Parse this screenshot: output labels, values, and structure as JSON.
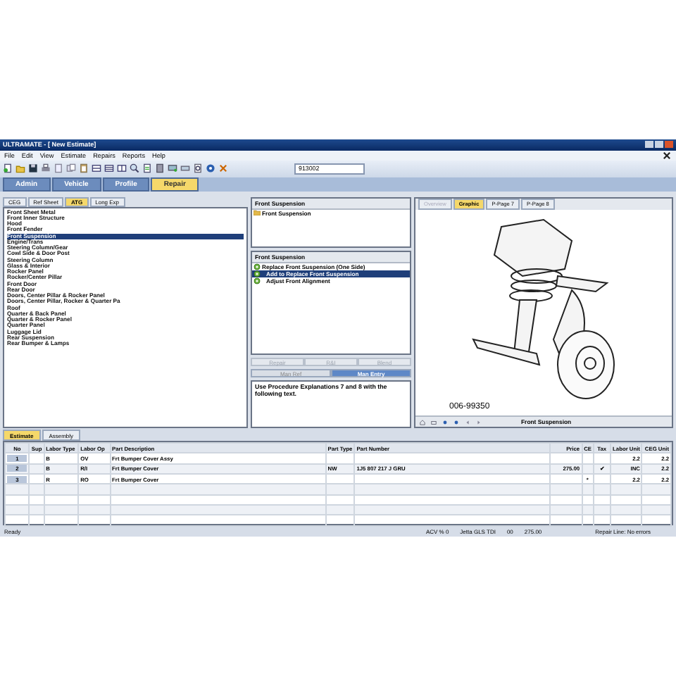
{
  "window": {
    "title": "ULTRAMATE - [ New Estimate]"
  },
  "menu": [
    "File",
    "Edit",
    "View",
    "Estimate",
    "Repairs",
    "Reports",
    "Help"
  ],
  "toolbar": {
    "field_value": "913002"
  },
  "nav_tabs": [
    {
      "label": "Admin",
      "selected": false
    },
    {
      "label": "Vehicle",
      "selected": false
    },
    {
      "label": "Profile",
      "selected": false
    },
    {
      "label": "Repair",
      "selected": true
    }
  ],
  "source_tabs": [
    {
      "label": "CEG",
      "selected": false
    },
    {
      "label": "Ref Sheet",
      "selected": false
    },
    {
      "label": "ATG",
      "selected": true
    },
    {
      "label": "Long Exp",
      "selected": false
    }
  ],
  "sections": [
    {
      "label": "Front Sheet Metal",
      "selected": false
    },
    {
      "label": "Front Inner Structure",
      "selected": false
    },
    {
      "label": "Hood",
      "selected": false
    },
    {
      "label": "Front Fender",
      "selected": false
    },
    {
      "label": "Front Suspension",
      "selected": true
    },
    {
      "label": "Engine/Trans",
      "selected": false
    },
    {
      "label": "Steering Column/Gear",
      "selected": false
    },
    {
      "label": "Cowl Side & Door Post",
      "selected": false
    },
    {
      "label": "Steering Column",
      "selected": false
    },
    {
      "label": "Glass & Interior",
      "selected": false
    },
    {
      "label": "Rocker Panel",
      "selected": false
    },
    {
      "label": "Rocker/Center Pillar",
      "selected": false
    },
    {
      "label": "Front Door",
      "selected": false
    },
    {
      "label": "Rear Door",
      "selected": false
    },
    {
      "label": "Doors, Center Pillar & Rocker Panel",
      "selected": false
    },
    {
      "label": "Doors, Center Pillar, Rocker & Quarter Pa",
      "selected": false
    },
    {
      "label": "Roof",
      "selected": false
    },
    {
      "label": "Quarter & Back Panel",
      "selected": false
    },
    {
      "label": "Quarter & Rocker Panel",
      "selected": false
    },
    {
      "label": "Quarter Panel",
      "selected": false
    },
    {
      "label": "Luggage Lid",
      "selected": false
    },
    {
      "label": "Rear Suspension",
      "selected": false
    },
    {
      "label": "Rear Bumper & Lamps",
      "selected": false
    }
  ],
  "groups": {
    "header": "Front Suspension",
    "items": [
      "Front Suspension"
    ]
  },
  "operations": {
    "header": "Front Suspension",
    "items": [
      {
        "label": "Replace Front Suspension (One Side)",
        "selected": false,
        "indented": false
      },
      {
        "label": "Add to Replace Front Suspension",
        "selected": true,
        "indented": true
      },
      {
        "label": "Adjust Front Alignment",
        "selected": false,
        "indented": true
      }
    ]
  },
  "actions": [
    {
      "label": "Repair",
      "disabled": true
    },
    {
      "label": "R&I",
      "disabled": true
    },
    {
      "label": "Blend",
      "disabled": true
    }
  ],
  "entry_tabs": [
    {
      "label": "Man Ref",
      "selected": false
    },
    {
      "label": "Man Entry",
      "selected": true
    }
  ],
  "note": "Use Procedure Explanations 7 and 8 with the following text.",
  "graphic_tabs": [
    {
      "label": "Overview",
      "selected": false,
      "disabled": true
    },
    {
      "label": "Graphic",
      "selected": true,
      "disabled": false
    },
    {
      "label": "P-Page 7",
      "selected": false,
      "disabled": false
    },
    {
      "label": "P-Page 8",
      "selected": false,
      "disabled": false
    }
  ],
  "graphic": {
    "caption": "006-99350",
    "nav_label": "Front Suspension"
  },
  "estimate_tabs": [
    {
      "label": "Estimate",
      "selected": true
    },
    {
      "label": "Assembly",
      "selected": false
    }
  ],
  "table": {
    "columns": [
      "No",
      "Sup",
      "Labor Type",
      "Labor Op",
      "Part Description",
      "Part Type",
      "Part Number",
      "Price",
      "CE",
      "Tax",
      "Labor Unit",
      "CEG Unit"
    ],
    "rows": [
      [
        "1",
        "",
        "B",
        "OV",
        "Frt Bumper Cover Assy",
        "",
        "",
        "",
        "",
        "",
        "2.2",
        "2.2"
      ],
      [
        "2",
        "",
        "B",
        "R/I",
        "Frt Bumper Cover",
        "NW",
        "1J5 807 217 J  GRU",
        "275.00",
        "",
        "✔",
        "INC",
        "2.2"
      ],
      [
        "3",
        "",
        "R",
        "RO",
        "Frt Bumper Cover",
        "",
        "",
        "",
        "*",
        "",
        "2.2",
        "2.2"
      ]
    ]
  },
  "status_bar": {
    "left": "Ready",
    "items": [
      "ACV % 0",
      "Jetta GLS TDI",
      "00",
      "275.00"
    ],
    "right": "Repair Line: No errors"
  }
}
